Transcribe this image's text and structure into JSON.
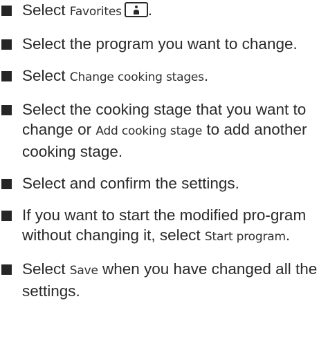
{
  "steps": [
    {
      "t1": "Select ",
      "ui1": "Favorites",
      "icon": "favorites-person-icon",
      "t2": "."
    },
    {
      "t1": "Select the program you want to change."
    },
    {
      "t1": "Select ",
      "ui1": "Change cooking stages",
      "t2": "."
    },
    {
      "t1": "Select the cooking stage that you want to change or ",
      "ui1": "Add cooking stage",
      "t2": " to add another cooking stage."
    },
    {
      "t1": "Select and confirm the settings."
    },
    {
      "t1": "If you want to start the modified pro-gram without changing it, select ",
      "ui1": "Start program",
      "t2": "."
    },
    {
      "t1": "Select ",
      "ui1": "Save",
      "t2": " when you have changed all the settings."
    }
  ]
}
